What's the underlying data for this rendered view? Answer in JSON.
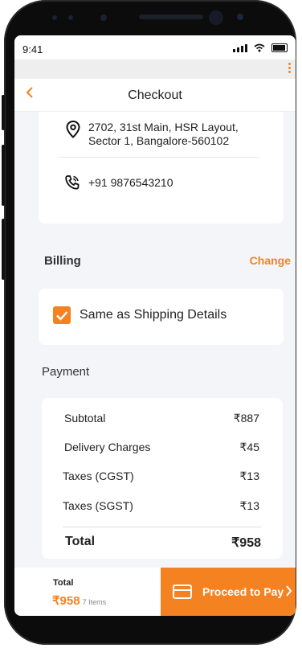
{
  "status": {
    "time": "9:41"
  },
  "header": {
    "title": "Checkout"
  },
  "address": {
    "line1": "2702, 31st Main, HSR Layout,",
    "line2": "Sector 1, Bangalore-560102",
    "phone": "+91 9876543210"
  },
  "billing": {
    "title": "Billing",
    "change_label": "Change",
    "same_as_shipping_label": "Same as Shipping Details",
    "same_as_shipping_checked": true
  },
  "payment": {
    "title": "Payment",
    "rows": [
      {
        "label": "Subtotal",
        "value": "₹887"
      },
      {
        "label": "Delivery Charges",
        "value": "₹45"
      },
      {
        "label": "Taxes (CGST)",
        "value": "₹13"
      },
      {
        "label": "Taxes (SGST)",
        "value": "₹13"
      }
    ],
    "total_label": "Total",
    "total_value": "₹958"
  },
  "footer": {
    "total_label": "Total",
    "amount": "₹958",
    "items": "7 Items",
    "proceed_label": "Proceed to Pay"
  },
  "colors": {
    "accent": "#f58220",
    "background": "#f4f5f8",
    "card": "#ffffff"
  },
  "icons": [
    "location-pin-icon",
    "phone-call-icon",
    "back-chevron-icon",
    "kebab-menu-icon",
    "card-icon",
    "chevron-right-icon",
    "checkmark-icon"
  ]
}
